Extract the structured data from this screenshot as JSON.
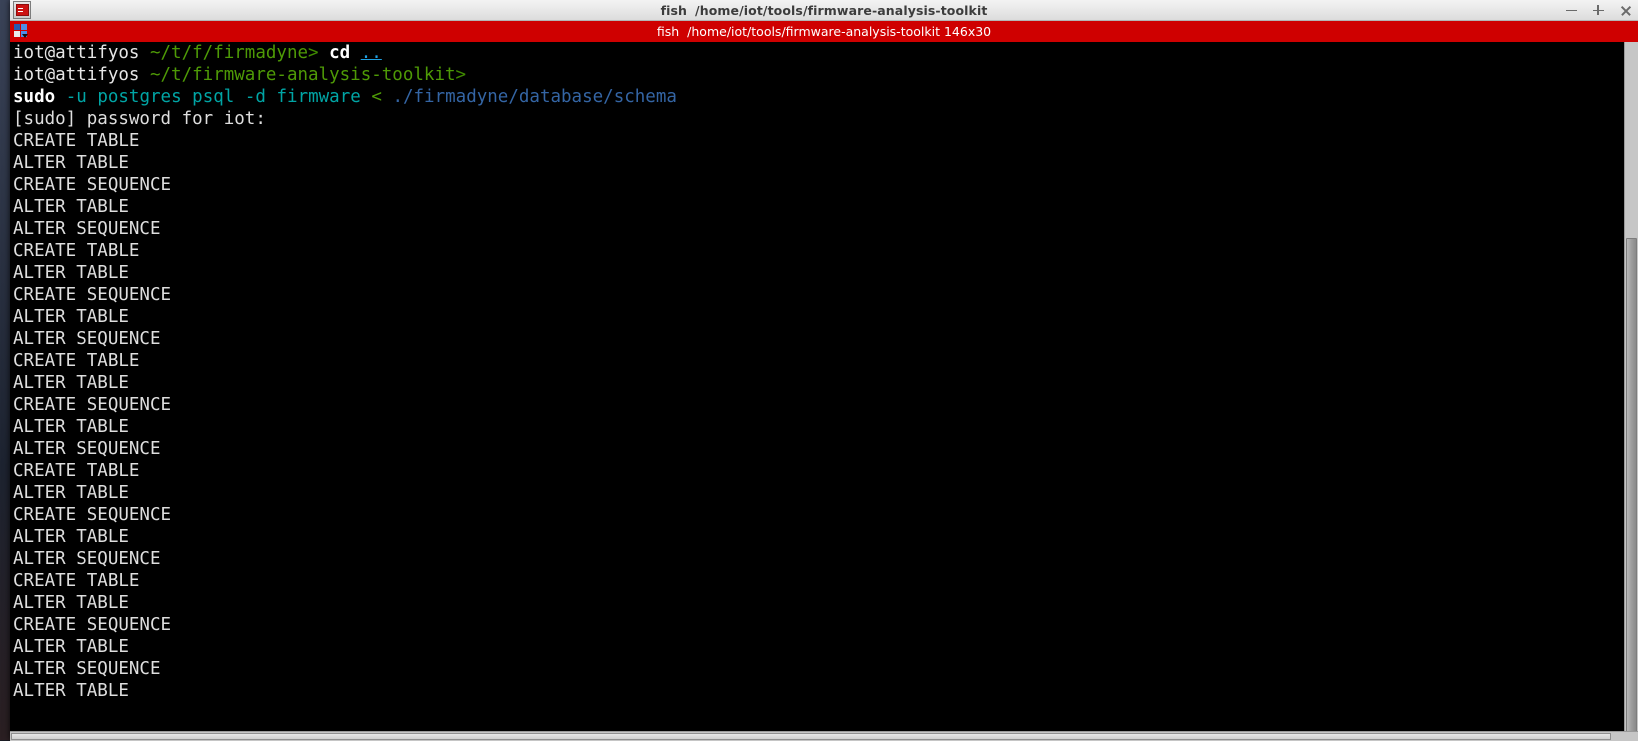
{
  "window": {
    "icon": "terminal-icon",
    "title_app": "fish",
    "title_path": "/home/iot/tools/firmware-analysis-toolkit",
    "controls": {
      "minimize": "−",
      "maximize": "+",
      "close": "×"
    }
  },
  "tab": {
    "icon": "tab-list-icon",
    "app": "fish",
    "path": "/home/iot/tools/firmware-analysis-toolkit",
    "size": "146x30",
    "bg_color": "#cf0000"
  },
  "terminal": {
    "bg_color": "#000000",
    "fg_color": "#d6d6d6",
    "cols": 146,
    "rows": 30,
    "prompt_1": {
      "user_host": "iot@attifyos",
      "cwd": "~/t/f/firmadyne",
      "arrow": ">",
      "command": "cd",
      "argument": ".."
    },
    "prompt_2": {
      "user_host": "iot@attifyos",
      "cwd": "~/t/firmware-analysis-toolkit",
      "arrow": ">"
    },
    "command_line": {
      "cmd": "sudo",
      "opt_u": "-u",
      "user": "postgres",
      "prog": "psql",
      "opt_d": "-d",
      "db": "firmware",
      "redirect": "<",
      "file": "./firmadyne/database/schema"
    },
    "password_prompt": "[sudo] password for iot:",
    "output_lines": [
      "CREATE TABLE",
      "ALTER TABLE",
      "CREATE SEQUENCE",
      "ALTER TABLE",
      "ALTER SEQUENCE",
      "CREATE TABLE",
      "ALTER TABLE",
      "CREATE SEQUENCE",
      "ALTER TABLE",
      "ALTER SEQUENCE",
      "CREATE TABLE",
      "ALTER TABLE",
      "CREATE SEQUENCE",
      "ALTER TABLE",
      "ALTER SEQUENCE",
      "CREATE TABLE",
      "ALTER TABLE",
      "CREATE SEQUENCE",
      "ALTER TABLE",
      "ALTER SEQUENCE",
      "CREATE TABLE",
      "ALTER TABLE",
      "CREATE SEQUENCE",
      "ALTER TABLE",
      "ALTER SEQUENCE",
      "ALTER TABLE"
    ]
  },
  "colors": {
    "accent_red": "#cf0000",
    "prompt_green": "#4e9a06",
    "arg_cyan": "#00a5a5",
    "path_blue": "#3465a4",
    "link_cyan": "#1f9ede"
  }
}
